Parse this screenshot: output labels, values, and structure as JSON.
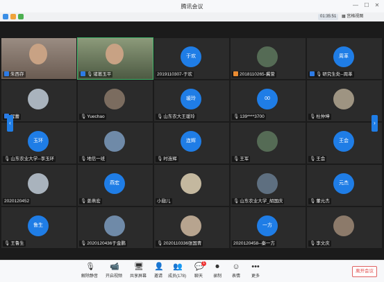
{
  "app": {
    "title": "腾讯会议",
    "timer": "01:35:51",
    "view_mode": "宫格视图"
  },
  "tiles": [
    {
      "name": "朱西存",
      "mic": false,
      "role": "user",
      "avatar": "",
      "kind": "camera"
    },
    {
      "name": "诸葛玉平",
      "mic": true,
      "role": "user",
      "avatar": "",
      "kind": "camera",
      "active": true
    },
    {
      "name": "2019110307-于欢",
      "mic": false,
      "role": "",
      "avatar": "于欢",
      "kind": "text"
    },
    {
      "name": "2018110265-冀萱",
      "mic": false,
      "role": "host",
      "avatar": "",
      "kind": "photo"
    },
    {
      "name": "研究生处--周革",
      "mic": true,
      "role": "user",
      "avatar": "周革",
      "kind": "text"
    },
    {
      "name": "程蕾",
      "mic": false,
      "role": "user",
      "avatar": "",
      "kind": "photo"
    },
    {
      "name": "Yuechao",
      "mic": true,
      "role": "",
      "avatar": "",
      "kind": "photo"
    },
    {
      "name": "山东农大王瑗玲",
      "mic": true,
      "role": "",
      "avatar": "瑗玲",
      "kind": "text"
    },
    {
      "name": "139****3700",
      "mic": true,
      "role": "",
      "avatar": "00",
      "kind": "text"
    },
    {
      "name": "杜仲坤",
      "mic": true,
      "role": "",
      "avatar": "",
      "kind": "photo"
    },
    {
      "name": "山东农业大学--李玉环",
      "mic": true,
      "role": "",
      "avatar": "玉环",
      "kind": "text"
    },
    {
      "name": "地信一班",
      "mic": true,
      "role": "",
      "avatar": "",
      "kind": "photo"
    },
    {
      "name": "时连辉",
      "mic": true,
      "role": "",
      "avatar": "连辉",
      "kind": "text"
    },
    {
      "name": "王军",
      "mic": true,
      "role": "",
      "avatar": "",
      "kind": "photo"
    },
    {
      "name": "王会",
      "mic": true,
      "role": "",
      "avatar": "王会",
      "kind": "text"
    },
    {
      "name": "2020120452",
      "mic": false,
      "role": "",
      "avatar": "",
      "kind": "photo"
    },
    {
      "name": "姜燕宏",
      "mic": true,
      "role": "",
      "avatar": "燕宏",
      "kind": "text"
    },
    {
      "name": "小翅儿",
      "mic": false,
      "role": "",
      "avatar": "",
      "kind": "photo"
    },
    {
      "name": "山东农业大学_胡国庆",
      "mic": true,
      "role": "",
      "avatar": "",
      "kind": "photo"
    },
    {
      "name": "董元杰",
      "mic": true,
      "role": "",
      "avatar": "元杰",
      "kind": "text"
    },
    {
      "name": "王鲁生",
      "mic": true,
      "role": "",
      "avatar": "鲁生",
      "kind": "text"
    },
    {
      "name": "2020120436于金鹏",
      "mic": true,
      "role": "",
      "avatar": "",
      "kind": "photo"
    },
    {
      "name": "2020110336张国青",
      "mic": true,
      "role": "",
      "avatar": "",
      "kind": "photo"
    },
    {
      "name": "2020120458--秦一方",
      "mic": false,
      "role": "",
      "avatar": "一方",
      "kind": "text"
    },
    {
      "name": "李文庆",
      "mic": true,
      "role": "",
      "avatar": "",
      "kind": "photo"
    }
  ],
  "toolbar": {
    "mute": "解除静音",
    "video": "开启视频",
    "share": "共享屏幕",
    "invite": "邀请",
    "members": "成员(178)",
    "chat": "聊天",
    "record": "录制",
    "expression": "表情",
    "more": "更多",
    "leave": "离开会议"
  },
  "colors": {
    "accent": "#1f7de6",
    "leave": "#e04848",
    "active_border": "#3fb86b"
  }
}
